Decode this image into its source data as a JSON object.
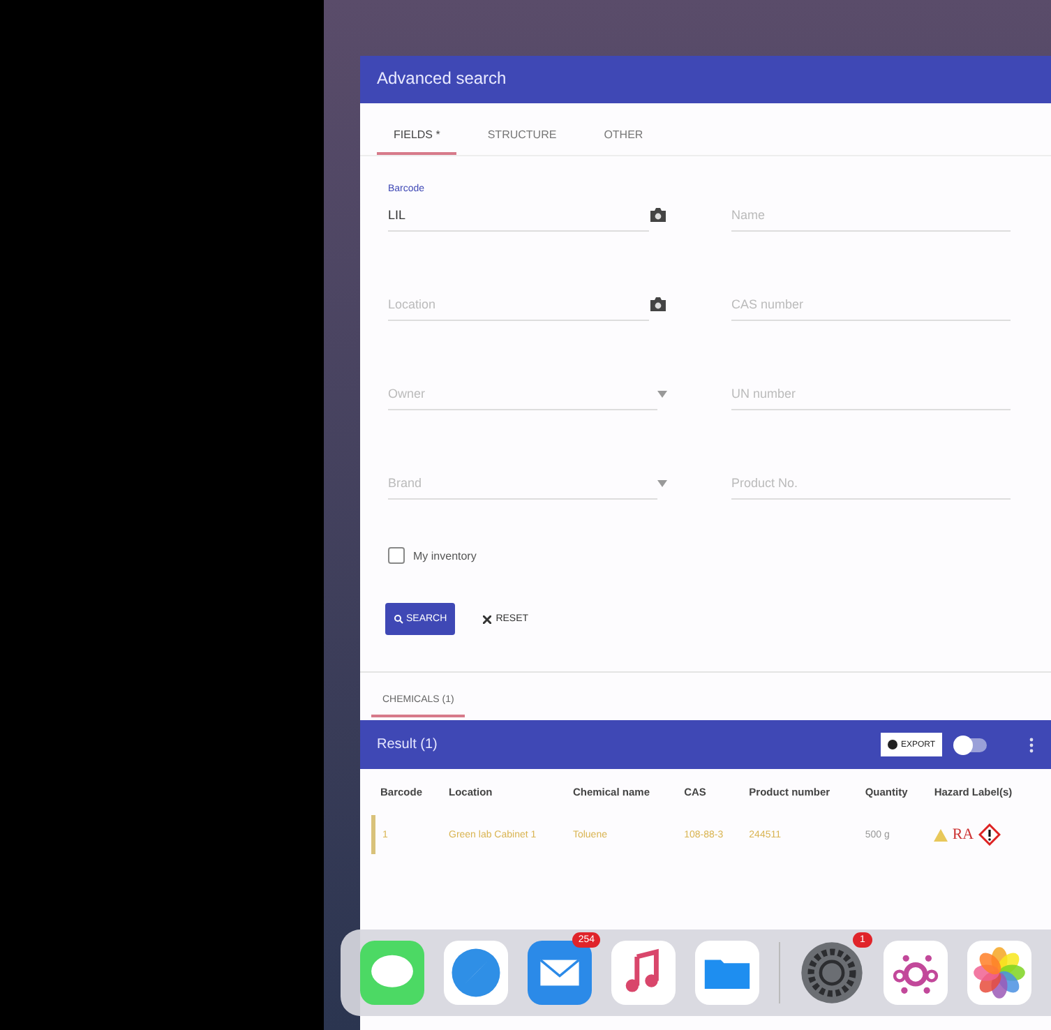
{
  "dialog": {
    "title": "Advanced search"
  },
  "tabs": [
    {
      "label": "FIELDS *",
      "selected": true
    },
    {
      "label": "STRUCTURE",
      "selected": false
    },
    {
      "label": "OTHER",
      "selected": false
    }
  ],
  "fields": [
    {
      "kind": "camera",
      "label": "Barcode",
      "value": "LIL"
    },
    {
      "kind": "text",
      "placeholder": "Name"
    },
    {
      "kind": "camera",
      "placeholder": "Location"
    },
    {
      "kind": "text",
      "placeholder": "CAS number"
    },
    {
      "kind": "select",
      "placeholder": "Owner"
    },
    {
      "kind": "text",
      "placeholder": "UN number"
    },
    {
      "kind": "select",
      "placeholder": "Brand"
    },
    {
      "kind": "text",
      "placeholder": "Product No."
    }
  ],
  "my_inventory": {
    "label": "My inventory",
    "checked": false
  },
  "buttons": {
    "search": "SEARCH",
    "reset": "RESET"
  },
  "result_tabs": [
    {
      "label": "CHEMICALS (1)",
      "selected": true
    }
  ],
  "result": {
    "title": "Result (1)",
    "export": "EXPORT",
    "toggle_on": false
  },
  "table": {
    "columns": [
      "Barcode",
      "Location",
      "Chemical name",
      "CAS",
      "Product number",
      "Quantity",
      "Hazard Label(s)"
    ],
    "rows": [
      {
        "barcode": "1",
        "location": "Green lab Cabinet 1",
        "chemical": "Toluene",
        "cas": "108-88-3",
        "product": "244511",
        "quantity": "500 g",
        "hazard": "RA"
      }
    ]
  },
  "dock": [
    {
      "kind": "messages"
    },
    {
      "kind": "safari"
    },
    {
      "kind": "mail",
      "badge": "254"
    },
    {
      "kind": "music"
    },
    {
      "kind": "files"
    },
    {
      "kind": "settings",
      "badge": "1"
    },
    {
      "kind": "dots"
    },
    {
      "kind": "photos"
    }
  ]
}
